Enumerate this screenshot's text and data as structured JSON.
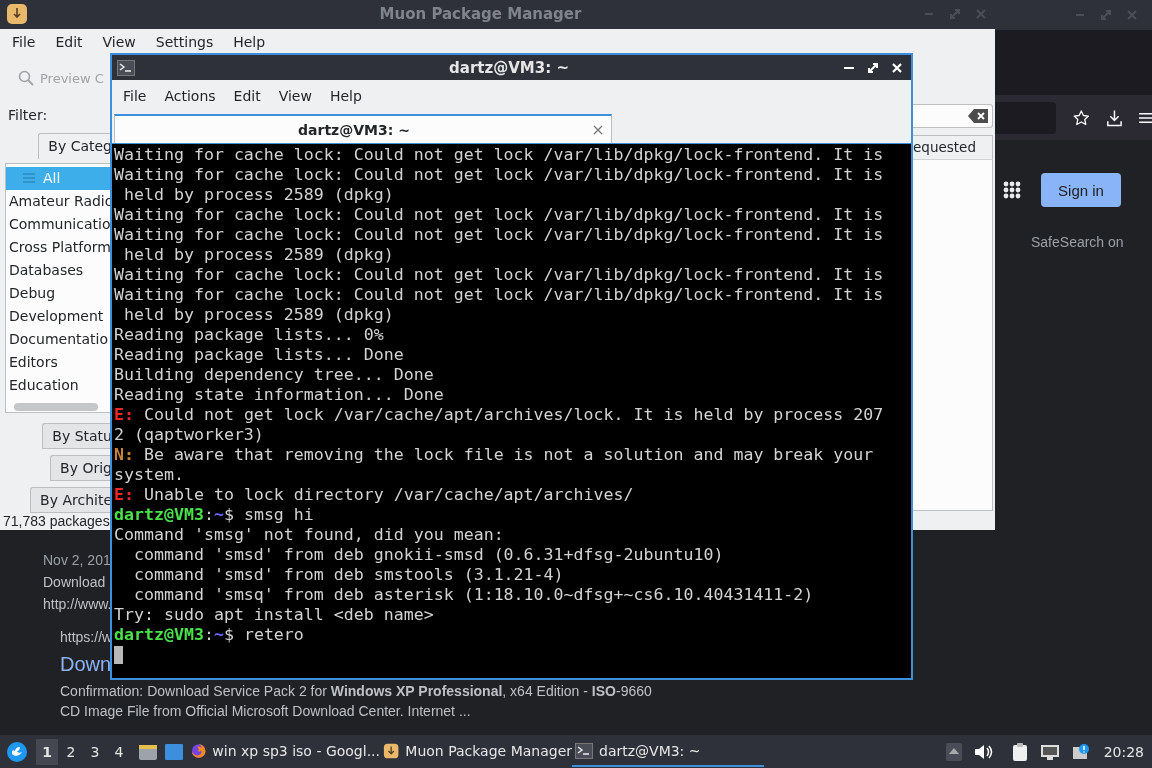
{
  "browser": {
    "sign_in": "Sign in",
    "safesearch": "SafeSearch on",
    "result": {
      "date": "Nov 2, 201",
      "snippet": "Download",
      "url": "http://www.",
      "cite": "https://w",
      "link": "Down",
      "description": "Confirmation: Download Service Pack 2 for **Windows XP Professional**, x64 Edition - **ISO**-9660",
      "description_2": "CD Image File from Official Microsoft Download Center. Internet ..."
    }
  },
  "muon": {
    "title": "Muon Package Manager",
    "menu": [
      "File",
      "Edit",
      "View",
      "Settings",
      "Help"
    ],
    "preview_button": {
      "label": "Preview C",
      "disabled": true
    },
    "filter_label": "Filter:",
    "filter_tabs": [
      {
        "label": "By Categ",
        "selected": true
      },
      {
        "label": "By Statu",
        "selected": false
      },
      {
        "label": "By Orig",
        "selected": false
      },
      {
        "label": "By Archite",
        "selected": false
      }
    ],
    "categories": [
      {
        "label": "All",
        "selected": true
      },
      {
        "label": "Amateur Radio",
        "selected": false
      },
      {
        "label": "Communicatio",
        "selected": false
      },
      {
        "label": "Cross Platform",
        "selected": false
      },
      {
        "label": "Databases",
        "selected": false
      },
      {
        "label": "Debug",
        "selected": false
      },
      {
        "label": "Development",
        "selected": false
      },
      {
        "label": "Documentatio",
        "selected": false
      },
      {
        "label": "Editors",
        "selected": false
      },
      {
        "label": "Education",
        "selected": false
      }
    ],
    "column_header": "equested",
    "status": "71,783 packages"
  },
  "terminal": {
    "title": "dartz@VM3: ~",
    "menu": [
      "File",
      "Actions",
      "Edit",
      "View",
      "Help"
    ],
    "tabs": [
      {
        "label": "dartz@VM3: ~",
        "selected": true
      }
    ],
    "lines": [
      [
        {
          "kind": "text",
          "text": "Waiting for cache lock: Could not get lock /var/lib/dpkg/lock-frontend. It is"
        }
      ],
      [
        {
          "kind": "text",
          "text": "Waiting for cache lock: Could not get lock /var/lib/dpkg/lock-frontend. It is"
        }
      ],
      [
        {
          "kind": "text",
          "text": " held by process 2589 (dpkg)"
        }
      ],
      [
        {
          "kind": "text",
          "text": "Waiting for cache lock: Could not get lock /var/lib/dpkg/lock-frontend. It is"
        }
      ],
      [
        {
          "kind": "text",
          "text": "Waiting for cache lock: Could not get lock /var/lib/dpkg/lock-frontend. It is"
        }
      ],
      [
        {
          "kind": "text",
          "text": " held by process 2589 (dpkg)"
        }
      ],
      [
        {
          "kind": "text",
          "text": "Waiting for cache lock: Could not get lock /var/lib/dpkg/lock-frontend. It is"
        }
      ],
      [
        {
          "kind": "text",
          "text": "Waiting for cache lock: Could not get lock /var/lib/dpkg/lock-frontend. It is"
        }
      ],
      [
        {
          "kind": "text",
          "text": " held by process 2589 (dpkg)"
        }
      ],
      [
        {
          "kind": "text",
          "text": "Reading package lists... 0%"
        }
      ],
      [
        {
          "kind": "text",
          "text": "Reading package lists... Done"
        }
      ],
      [
        {
          "kind": "text",
          "text": "Building dependency tree... Done"
        }
      ],
      [
        {
          "kind": "text",
          "text": "Reading state information... Done"
        }
      ],
      [
        {
          "kind": "error",
          "text": "E:"
        },
        {
          "kind": "text",
          "text": " Could not get lock /var/cache/apt/archives/lock. It is held by process 207"
        }
      ],
      [
        {
          "kind": "text",
          "text": "2 (qaptworker3)"
        }
      ],
      [
        {
          "kind": "notice",
          "text": "N:"
        },
        {
          "kind": "text",
          "text": " Be aware that removing the lock file is not a solution and may break your"
        }
      ],
      [
        {
          "kind": "text",
          "text": "system."
        }
      ],
      [
        {
          "kind": "error",
          "text": "E:"
        },
        {
          "kind": "text",
          "text": " Unable to lock directory /var/cache/apt/archives/"
        }
      ],
      [
        {
          "kind": "user",
          "text": "dartz@VM3"
        },
        {
          "kind": "text",
          "text": ":"
        },
        {
          "kind": "path",
          "text": "~"
        },
        {
          "kind": "text",
          "text": "$ smsg hi"
        }
      ],
      [
        {
          "kind": "text",
          "text": "Command 'smsg' not found, did you mean:"
        }
      ],
      [
        {
          "kind": "text",
          "text": "  command 'smsd' from deb gnokii-smsd (0.6.31+dfsg-2ubuntu10)"
        }
      ],
      [
        {
          "kind": "text",
          "text": "  command 'smsd' from deb smstools (3.1.21-4)"
        }
      ],
      [
        {
          "kind": "text",
          "text": "  command 'smsq' from deb asterisk (1:18.10.0~dfsg+~cs6.10.40431411-2)"
        }
      ],
      [
        {
          "kind": "text",
          "text": "Try: sudo apt install <deb name>"
        }
      ],
      [
        {
          "kind": "user",
          "text": "dartz@VM3"
        },
        {
          "kind": "text",
          "text": ":"
        },
        {
          "kind": "path",
          "text": "~"
        },
        {
          "kind": "text",
          "text": "$ retero"
        }
      ]
    ],
    "cursor": true
  },
  "taskbar": {
    "workspaces": [
      {
        "label": "1",
        "selected": true
      },
      {
        "label": "2",
        "selected": false
      },
      {
        "label": "3",
        "selected": false
      },
      {
        "label": "4",
        "selected": false
      }
    ],
    "tasks": [
      {
        "kind": "browser",
        "label": "win xp sp3 iso - Googl...",
        "selected": false
      },
      {
        "kind": "package-manager",
        "label": "Muon Package Manager",
        "selected": false
      },
      {
        "kind": "terminal",
        "label": "dartz@VM3: ~",
        "selected": true
      }
    ],
    "clock": "20:28"
  }
}
